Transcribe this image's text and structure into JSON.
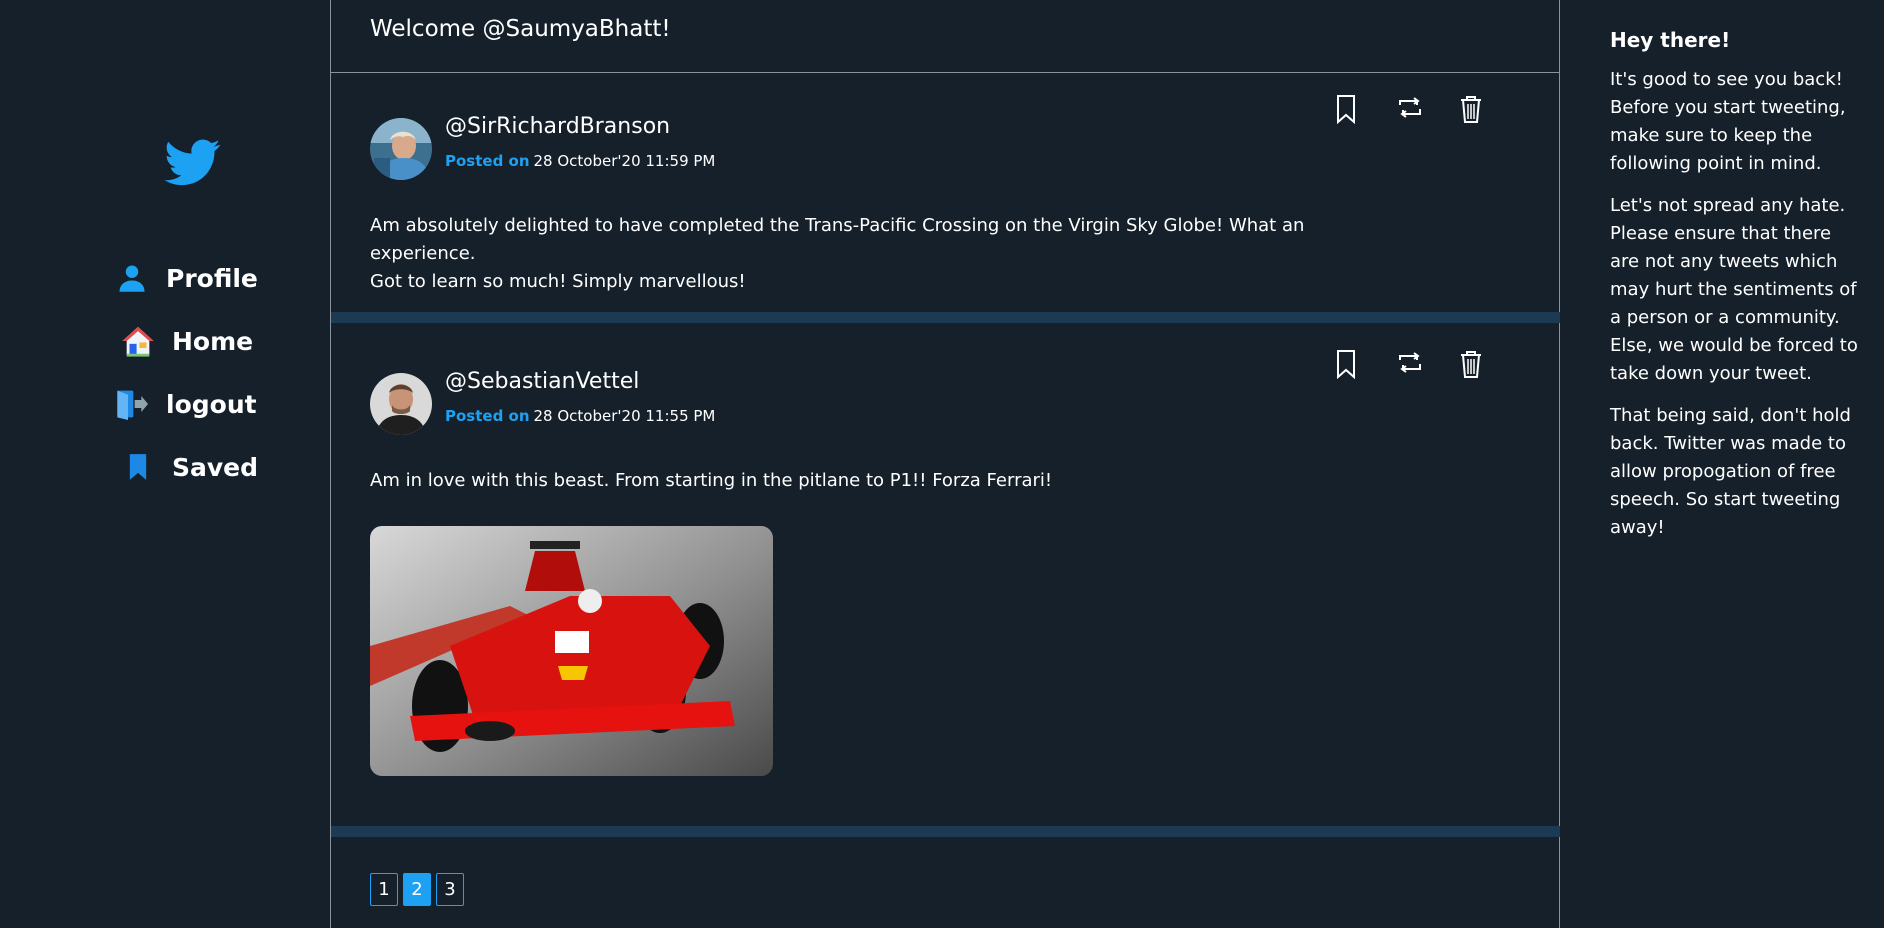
{
  "sidebar": {
    "logo_icon": "twitter-bird-icon",
    "items": [
      {
        "label": "Profile",
        "icon": "person-icon"
      },
      {
        "label": "Home",
        "icon": "house-icon"
      },
      {
        "label": "logout",
        "icon": "door-exit-icon"
      },
      {
        "label": "Saved",
        "icon": "bookmark-icon"
      }
    ]
  },
  "main": {
    "welcome": "Welcome @SaumyaBhatt!",
    "tweets": [
      {
        "handle": "@SirRichardBranson",
        "posted_label": "Posted on",
        "posted_date": "28 October'20 11:59 PM",
        "text_line1": "Am absolutely delighted to have completed the Trans-Pacific Crossing on the Virgin Sky Globe! What an experience.",
        "text_line2": "Got to learn so much! Simply marvellous!"
      },
      {
        "handle": "@SebastianVettel",
        "posted_label": "Posted on",
        "posted_date": "28 October'20 11:55 PM",
        "text_line1": "Am in love with this beast. From starting in the pitlane to P1!! Forza Ferrari!",
        "image": "red-f1-car-image"
      }
    ],
    "pagination": {
      "pages": [
        "1",
        "2",
        "3"
      ],
      "active": "2"
    }
  },
  "right_panel": {
    "title": "Hey there!",
    "paragraphs": [
      "It's good to see you back! Before you start tweeting, make sure to keep the following point in mind.",
      "Let's not spread any hate. Please ensure that there are not any tweets which may hurt the sentiments of a person or a community. Else, we would be forced to take down your tweet.",
      "That being said, don't hold back. Twitter was made to allow propogation of free speech. So start tweeting away!"
    ]
  },
  "colors": {
    "background": "#15202b",
    "accent": "#1da1f2",
    "divider_band": "#1c3a52",
    "border": "#8a939c"
  }
}
